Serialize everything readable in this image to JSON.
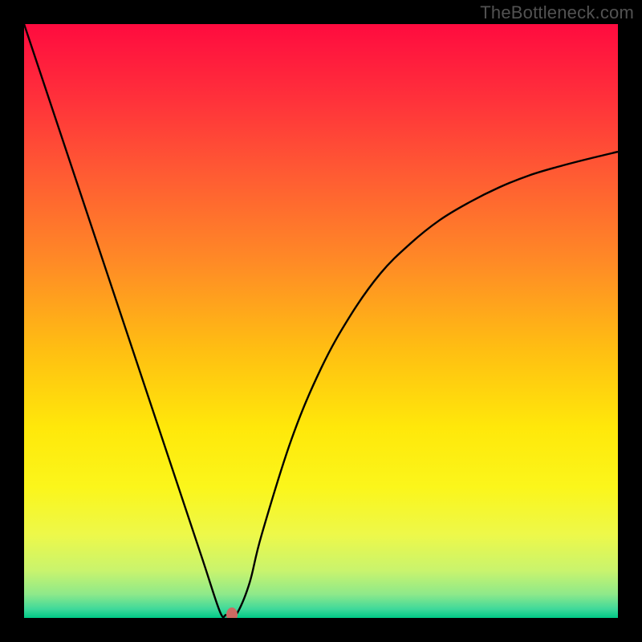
{
  "watermark": "TheBottleneck.com",
  "chart_data": {
    "type": "line",
    "title": "",
    "xlabel": "",
    "ylabel": "",
    "xlim": [
      0,
      100
    ],
    "ylim": [
      0,
      100
    ],
    "series": [
      {
        "name": "curve",
        "x": [
          0,
          5,
          10,
          15,
          20,
          25,
          30,
          33,
          34,
          35,
          36,
          38,
          40,
          45,
          50,
          55,
          60,
          65,
          70,
          75,
          80,
          85,
          90,
          95,
          100
        ],
        "values": [
          100,
          85,
          70,
          55,
          40,
          25,
          10,
          1,
          0.5,
          0.5,
          1,
          6,
          14,
          30,
          42,
          51,
          58,
          63,
          67,
          70,
          72.5,
          74.5,
          76,
          77.3,
          78.5
        ]
      }
    ],
    "marker": {
      "x": 35,
      "y": 0.5
    },
    "gradient_stops": [
      {
        "pos": 0,
        "color": "#ff0b3f"
      },
      {
        "pos": 0.12,
        "color": "#ff2f3b"
      },
      {
        "pos": 0.25,
        "color": "#ff5a33"
      },
      {
        "pos": 0.4,
        "color": "#ff8a26"
      },
      {
        "pos": 0.55,
        "color": "#ffbf12"
      },
      {
        "pos": 0.68,
        "color": "#ffe80a"
      },
      {
        "pos": 0.78,
        "color": "#fbf61b"
      },
      {
        "pos": 0.86,
        "color": "#edf84a"
      },
      {
        "pos": 0.92,
        "color": "#c9f46d"
      },
      {
        "pos": 0.96,
        "color": "#8ee98a"
      },
      {
        "pos": 0.985,
        "color": "#3fd99a"
      },
      {
        "pos": 1.0,
        "color": "#00c985"
      }
    ]
  }
}
